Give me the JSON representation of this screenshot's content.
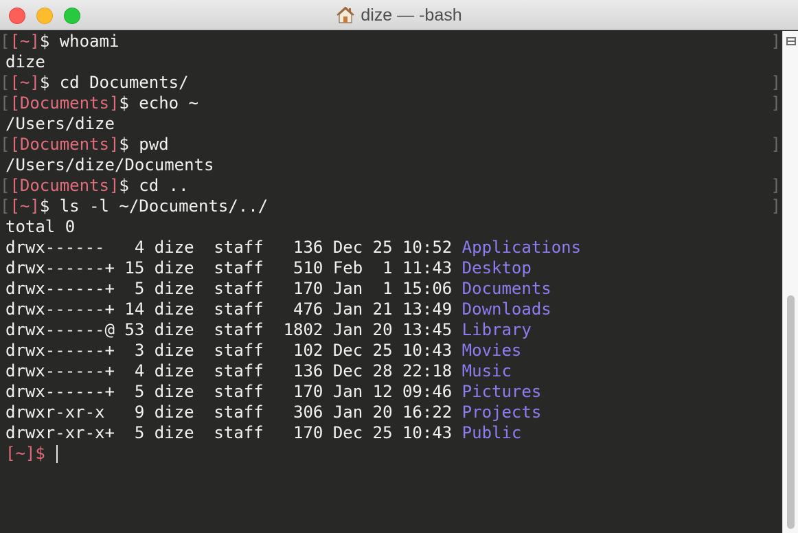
{
  "window": {
    "title": "dize — -bash"
  },
  "terminal": {
    "prompt_home": "[~]$",
    "prompt_docs": "[Documents]$",
    "prompt_home_bracket": "[~]",
    "prompt_docs_bracket": "[Documents]",
    "dollar": "$",
    "lines": [
      {
        "cmd": " whoami"
      },
      {
        "out": "dize"
      },
      {
        "cmd": " cd Documents/"
      },
      {
        "cmd": " echo ~"
      },
      {
        "out": "/Users/dize"
      },
      {
        "cmd": " pwd"
      },
      {
        "out": "/Users/dize/Documents"
      },
      {
        "cmd": " cd .."
      },
      {
        "cmd": " ls -l ~/Documents/../"
      },
      {
        "out": "total 0"
      }
    ],
    "listing": [
      {
        "meta": "drwx------   4 dize  staff   136 Dec 25 10:52 ",
        "name": "Applications"
      },
      {
        "meta": "drwx------+ 15 dize  staff   510 Feb  1 11:43 ",
        "name": "Desktop"
      },
      {
        "meta": "drwx------+  5 dize  staff   170 Jan  1 15:06 ",
        "name": "Documents"
      },
      {
        "meta": "drwx------+ 14 dize  staff   476 Jan 21 13:49 ",
        "name": "Downloads"
      },
      {
        "meta": "drwx------@ 53 dize  staff  1802 Jan 20 13:45 ",
        "name": "Library"
      },
      {
        "meta": "drwx------+  3 dize  staff   102 Dec 25 10:43 ",
        "name": "Movies"
      },
      {
        "meta": "drwx------+  4 dize  staff   136 Dec 28 22:18 ",
        "name": "Music"
      },
      {
        "meta": "drwx------+  5 dize  staff   170 Jan 12 09:46 ",
        "name": "Pictures"
      },
      {
        "meta": "drwxr-xr-x   9 dize  staff   306 Jan 20 16:22 ",
        "name": "Projects"
      },
      {
        "meta": "drwxr-xr-x+  5 dize  staff   170 Dec 25 10:43 ",
        "name": "Public"
      }
    ]
  },
  "colors": {
    "background": "#282826",
    "prompt": "#e06c7c",
    "directory": "#8d7df2",
    "text": "#f2f2f2",
    "close": "#fc5f57",
    "minimize": "#fdbc2e",
    "maximize": "#28c840"
  },
  "icons": {
    "title_icon": "home-icon",
    "scroll_split": "split-pane-icon"
  }
}
